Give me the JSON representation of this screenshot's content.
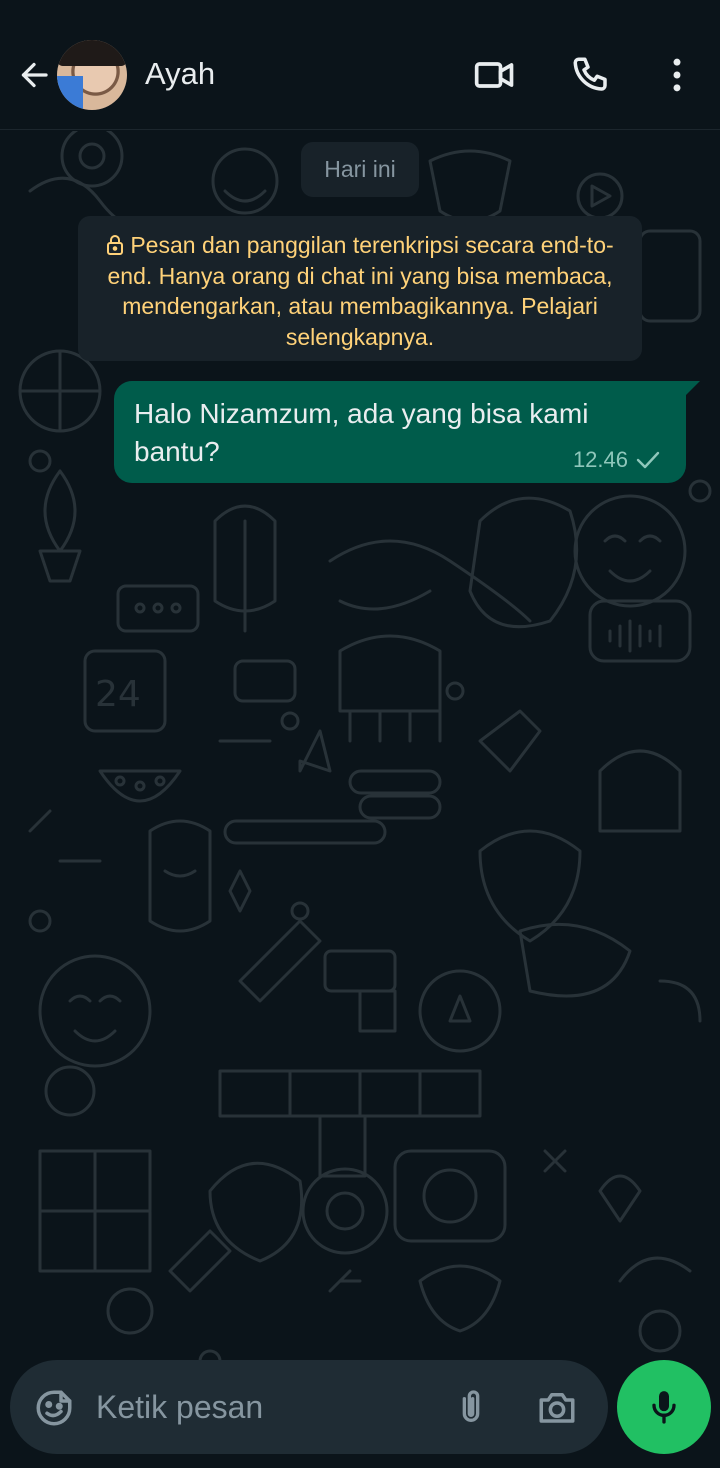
{
  "header": {
    "contact_name": "Ayah",
    "back_icon": "arrow-left-icon",
    "video_icon": "video-camera-icon",
    "call_icon": "phone-icon",
    "menu_icon": "more-vertical-icon"
  },
  "chat": {
    "date_chip": "Hari ini",
    "encryption_notice": "Pesan dan panggilan terenkripsi secara end-to-end. Hanya orang di chat ini yang bisa membaca, mendengarkan, atau membagikannya. Pelajari selengkapnya.",
    "messages": [
      {
        "direction": "outgoing",
        "text": "Halo Nizamzum, ada yang bisa kami bantu?",
        "time": "12.46",
        "status": "sent"
      }
    ]
  },
  "composer": {
    "placeholder": "Ketik pesan",
    "emoji_icon": "sticker-icon",
    "attach_icon": "paperclip-icon",
    "camera_icon": "camera-icon",
    "mic_icon": "microphone-icon"
  },
  "colors": {
    "background": "#0b141a",
    "outgoing_bubble": "#005c4b",
    "notice_text": "#ffd279",
    "accent": "#21c063"
  }
}
